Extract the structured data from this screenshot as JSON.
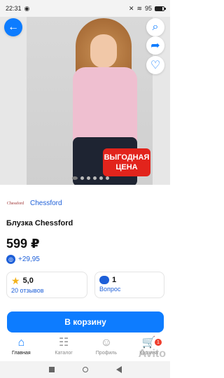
{
  "status_bar": {
    "time": "22:31",
    "battery": "95"
  },
  "product_images": {
    "promo_line1": "ВЫГОДНАЯ",
    "promo_line2": "ЦЕНА",
    "current_index": 0,
    "total": 6
  },
  "seller": {
    "logo_text": "Chessford",
    "name": "Chessford"
  },
  "product": {
    "title": "Блузка Chessford",
    "price": "599 ₽",
    "bonus": "+29,95"
  },
  "stats": {
    "rating_value": "5,0",
    "reviews_label": "20 отзывов",
    "questions_count": "1",
    "questions_label": "Вопрос"
  },
  "actions": {
    "cart_button": "В корзину"
  },
  "bottom_nav": {
    "items": [
      {
        "label": "Главная"
      },
      {
        "label": "Каталог"
      },
      {
        "label": "Профиль"
      },
      {
        "label": "Корзина"
      }
    ],
    "cart_badge": "1"
  },
  "watermark": "Avito",
  "colors": {
    "accent": "#0d7cff",
    "promo": "#e2241c",
    "link": "#1d5fd8",
    "star": "#f3b21a"
  }
}
